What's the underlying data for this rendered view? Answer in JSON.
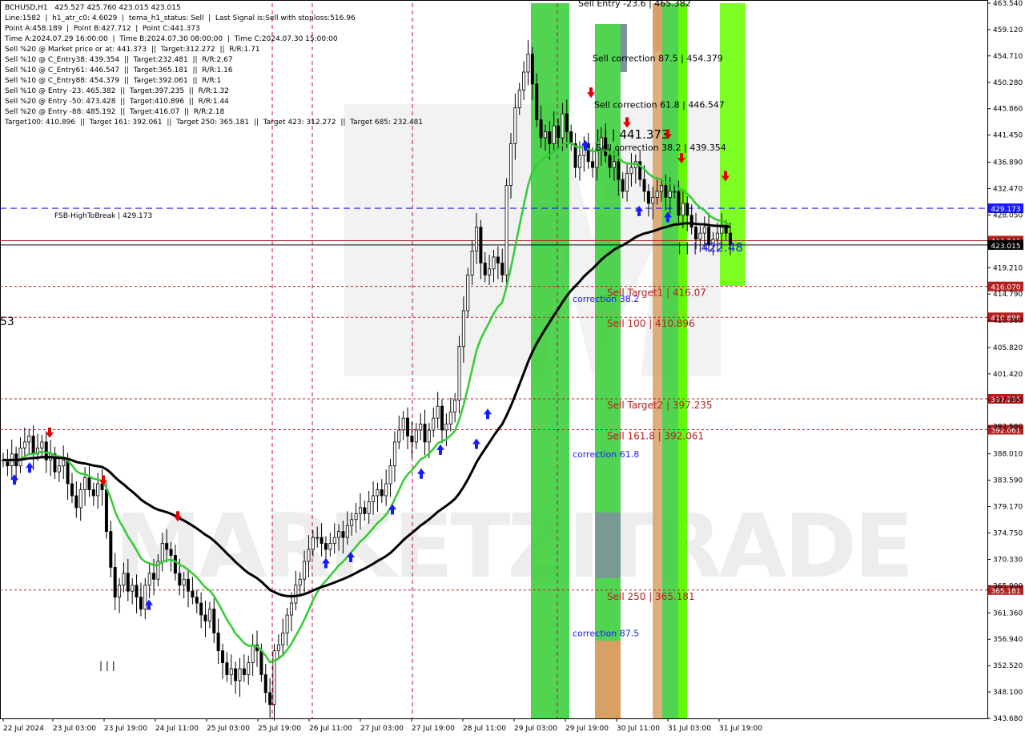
{
  "header_lines": [
    "BCHUSD,H1   425.527 425.760 423.015 423.015",
    "Line:1582  |  h1_atr_c0: 4.6029  |  tema_h1_status: Sell  |  Last Signal is:Sell with stoploss:516.96",
    "Point A:458.189  |  Point B:427.712  |  Point C:441.373",
    "Time A:2024.07.29 16:00:00  |  Time B:2024.07.30 08:00:00  |  Time C:2024.07.30 15:00:00",
    "Sell %20 @ Market price or at: 441.373  ||  Target:312.272  ||  R/R:1.71",
    "Sell %10 @ C_Entry38: 439.354  ||  Target:232.481  ||  R/R:2.67",
    "Sell %10 @ C_Entry61: 446.547  ||  Target:365.181  ||  R/R:1.16",
    "Sell %10 @ C_Entry88: 454.379  ||  Target:392.061  ||  R/R:1",
    "Sell %10 @ Entry -23: 465.382  ||  Target:397.235  ||  R/R:1.32",
    "Sell %20 @ Entry -50: 473.428  ||  Target:410.896  ||  R/R:1.44",
    "Sell %20 @ Entry -88: 485.192  ||  Target:416.07  ||  R/R:2.18",
    "Target100: 410.896  ||  Target 161: 392.061  ||  Target 250: 365.181  ||  Target 423: 312.272  ||  Target 685: 232.481"
  ],
  "watermark": "MARKETZITRADE",
  "colors": {
    "bull_candle": "#000000",
    "bear_candle": "#000000",
    "ma_fast": "#33cc33",
    "ma_slow": "#000000",
    "blue_level": "#1a1aff",
    "red_level": "#b22222",
    "zone_green": "#33cc33",
    "zone_lime": "#66ff00",
    "zone_orange": "#d9a066",
    "zone_gray": "#8090a0",
    "arrow_up": "#1a1aff",
    "arrow_down": "#e00000",
    "price_tag_current": "#000000"
  },
  "chart_data": {
    "type": "candlestick",
    "symbol": "BCHUSD",
    "timeframe": "H1",
    "ylim": [
      343.68,
      463.54
    ],
    "price_ticks": [
      "463.540",
      "459.120",
      "454.710",
      "450.280",
      "445.860",
      "441.450",
      "436.890",
      "432.470",
      "428.050",
      "423.630",
      "419.210",
      "414.790",
      "410.360",
      "405.820",
      "401.420",
      "397.000",
      "392.580",
      "388.010",
      "383.590",
      "379.170",
      "374.750",
      "370.330",
      "365.900",
      "361.360",
      "356.940",
      "352.520",
      "348.100",
      "343.680"
    ],
    "time_labels": [
      "22 Jul 2024",
      "23 Jul 03:00",
      "23 Jul 19:00",
      "24 Jul 11:00",
      "25 Jul 03:00",
      "25 Jul 19:00",
      "26 Jul 11:00",
      "27 Jul 03:00",
      "27 Jul 19:00",
      "28 Jul 11:00",
      "29 Jul 03:00",
      "29 Jul 19:00",
      "30 Jul 11:00",
      "31 Jul 03:00",
      "31 Jul 19:00"
    ],
    "bars_count": 240,
    "closes": [
      387,
      386,
      388,
      386,
      389,
      390,
      391,
      388,
      389,
      390,
      387,
      388,
      385,
      386,
      387,
      383,
      381,
      379,
      382,
      384,
      382,
      381,
      383,
      382,
      375,
      369,
      364,
      366,
      368,
      365,
      366,
      364,
      362,
      366,
      368,
      367,
      370,
      373,
      372,
      371,
      368,
      366,
      367,
      365,
      364,
      363,
      361,
      360,
      362,
      358,
      355,
      353,
      351,
      352,
      350,
      352,
      351,
      353,
      356,
      355,
      351,
      348,
      346,
      355,
      356,
      358,
      361,
      363,
      366,
      367,
      370,
      372,
      374,
      374,
      373,
      372,
      373,
      374,
      375,
      374,
      376,
      377,
      378,
      379,
      378,
      380,
      381,
      382,
      381,
      383,
      386,
      390,
      392,
      394,
      391,
      390,
      392,
      393,
      390,
      392,
      394,
      396,
      392,
      393,
      395,
      397,
      406,
      412,
      418,
      422,
      426,
      420,
      418,
      419,
      421,
      420,
      418,
      433,
      440,
      446,
      449,
      452,
      455,
      450,
      444,
      441,
      442,
      440,
      443,
      441,
      445,
      442,
      440,
      436,
      438,
      440,
      437,
      436,
      439,
      441,
      438,
      436,
      437,
      434,
      432,
      435,
      436,
      437,
      434,
      432,
      430,
      431,
      432,
      433,
      431,
      432,
      432,
      428,
      430,
      428,
      426,
      424,
      425,
      426,
      423,
      424,
      425,
      426,
      425,
      423
    ],
    "ma_fast": {
      "name": "",
      "values": [
        0
      ]
    },
    "ma_slow": {
      "name": "",
      "values": [
        0
      ]
    },
    "levels": [
      {
        "label": "FSB-HighToBreak | 429.173",
        "price": 429.173,
        "tag": "429.173",
        "color": "blue",
        "style": "dashed"
      },
      {
        "label": "",
        "price": 423.749,
        "tag": "423.749",
        "color": "red",
        "style": "solid"
      },
      {
        "label": "",
        "price": 423.015,
        "tag": "423.015",
        "color": "black",
        "style": "solid"
      },
      {
        "label": "Sell Target1 | 416.07",
        "price": 416.07,
        "tag": "416.070",
        "color": "red",
        "style": "dashed"
      },
      {
        "label": "Sell 100 | 410.896",
        "price": 410.896,
        "tag": "410.896",
        "color": "red",
        "style": "dashed"
      },
      {
        "label": "Sell Target2 | 397.235",
        "price": 397.235,
        "tag": "397.235",
        "color": "red",
        "style": "dashed"
      },
      {
        "label": "Sell 161.8 | 392.061",
        "price": 392.061,
        "tag": "392.061",
        "color": "red",
        "style": "dashed"
      },
      {
        "label": "Sell 250 | 365.181",
        "price": 365.181,
        "tag": "365.181",
        "color": "red",
        "style": "dashed"
      }
    ],
    "annotations": [
      {
        "text": "Sell correction 87.5 | 454.379",
        "price": 454.379,
        "color": "#000000"
      },
      {
        "text": "Sell correction 61.8 | 446.547",
        "price": 446.547,
        "color": "#000000"
      },
      {
        "text": "Sell correction 38.2 | 439.354",
        "price": 439.354,
        "color": "#000000"
      },
      {
        "text": "| | | 441.373",
        "price": 441.373,
        "color": "#000000"
      },
      {
        "text": "| | | 422.48",
        "price": 422.48,
        "color": "#1a1aff"
      },
      {
        "text": "correction 38.2",
        "price": 414.0,
        "color": "#1a1aff"
      },
      {
        "text": "correction 61.8",
        "price": 388.0,
        "color": "#1a1aff"
      },
      {
        "text": "correction 87.5",
        "price": 358.0,
        "color": "#1a1aff"
      },
      {
        "text": "Sell Entry -23.6 | 465.382",
        "price": 463.54,
        "color": "#000000"
      }
    ],
    "left_cut_label": "53",
    "bottom_left_marks": "| | |"
  }
}
